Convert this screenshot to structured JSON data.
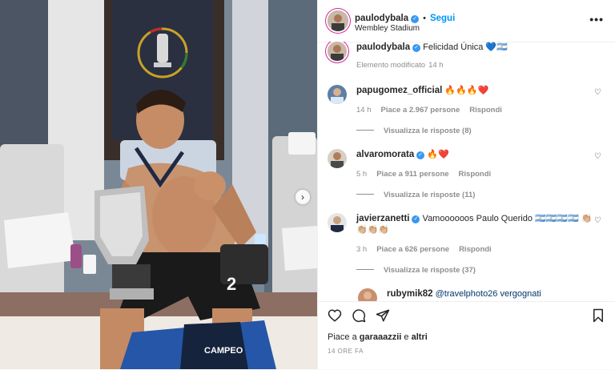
{
  "post": {
    "username": "paulodybala",
    "follow_label": "Segui",
    "location": "Wembley Stadium",
    "more_icon": "ellipsis-icon",
    "caption_text": "Felicidad Única 💙🇦🇷",
    "caption_edited": "Elemento modificato",
    "caption_time": "14 h"
  },
  "comments": [
    {
      "username": "papugomez_official",
      "text": "🔥🔥🔥❤️",
      "time": "14 h",
      "likes": "Piace a 2.967 persone",
      "reply_label": "Rispondi",
      "view_replies": "Visualizza le risposte (8)"
    },
    {
      "username": "alvaromorata",
      "text": "🔥❤️",
      "time": "5 h",
      "likes": "Piace a 911 persone",
      "reply_label": "Rispondi",
      "view_replies": "Visualizza le risposte (11)"
    },
    {
      "username": "javierzanetti",
      "text": "Vamoooooos Paulo Querido 🇦🇷🇦🇷🇦🇷🇦🇷 👏🏼👏🏼👏🏼👏🏼",
      "time": "3 h",
      "likes": "Piace a 626 persone",
      "reply_label": "Rispondi",
      "view_replies": "Visualizza le risposte (37)"
    },
    {
      "username": "rubymik82",
      "text": "@travelphoto26 vergognati"
    }
  ],
  "actions": {
    "like_icon": "heart-icon",
    "comment_icon": "comment-icon",
    "share_icon": "paper-plane-icon",
    "save_icon": "bookmark-icon",
    "likes_prefix": "Piace a",
    "likes_user": "garaaazzii",
    "likes_and": "e",
    "likes_others": "altri",
    "time_ago": "14 ORE FA"
  },
  "photo": {
    "shirt_text": "CAMPEO",
    "jersey_number": "2"
  },
  "colors": {
    "link_blue": "#0095f6",
    "verified_blue": "#3897f0",
    "muted": "#8e8e8e"
  }
}
